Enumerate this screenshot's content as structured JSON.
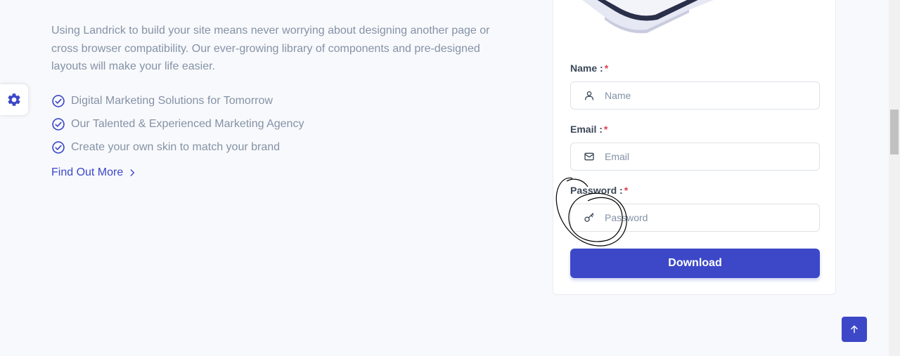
{
  "intro": {
    "text": "Using Landrick to build your site means never worrying about designing another page or cross browser compatibility. Our ever-growing library of components and pre-designed layouts will make your life easier."
  },
  "features": [
    {
      "label": "Digital Marketing Solutions for Tomorrow",
      "icon": "check-circle-icon"
    },
    {
      "label": "Our Talented & Experienced Marketing Agency",
      "icon": "check-circle-icon"
    },
    {
      "label": "Create your own skin to match your brand",
      "icon": "check-circle-icon"
    }
  ],
  "cta": {
    "label": "Find Out More",
    "icon": "chevron-right-icon"
  },
  "form": {
    "name_label": "Name :",
    "name_placeholder": "Name",
    "email_label": "Email :",
    "email_placeholder": "Email",
    "password_label": "Password :",
    "password_placeholder": "Password",
    "required_mark": "*",
    "submit_label": "Download"
  },
  "colors": {
    "primary": "#3c48c8",
    "muted_text": "#8492a6",
    "required": "#e43f52",
    "background": "#f8f9fc"
  },
  "icons": {
    "settings": "gear-icon",
    "name_field": "user-icon",
    "email_field": "mail-icon",
    "password_field": "key-icon",
    "back_to_top": "arrow-up-icon"
  }
}
